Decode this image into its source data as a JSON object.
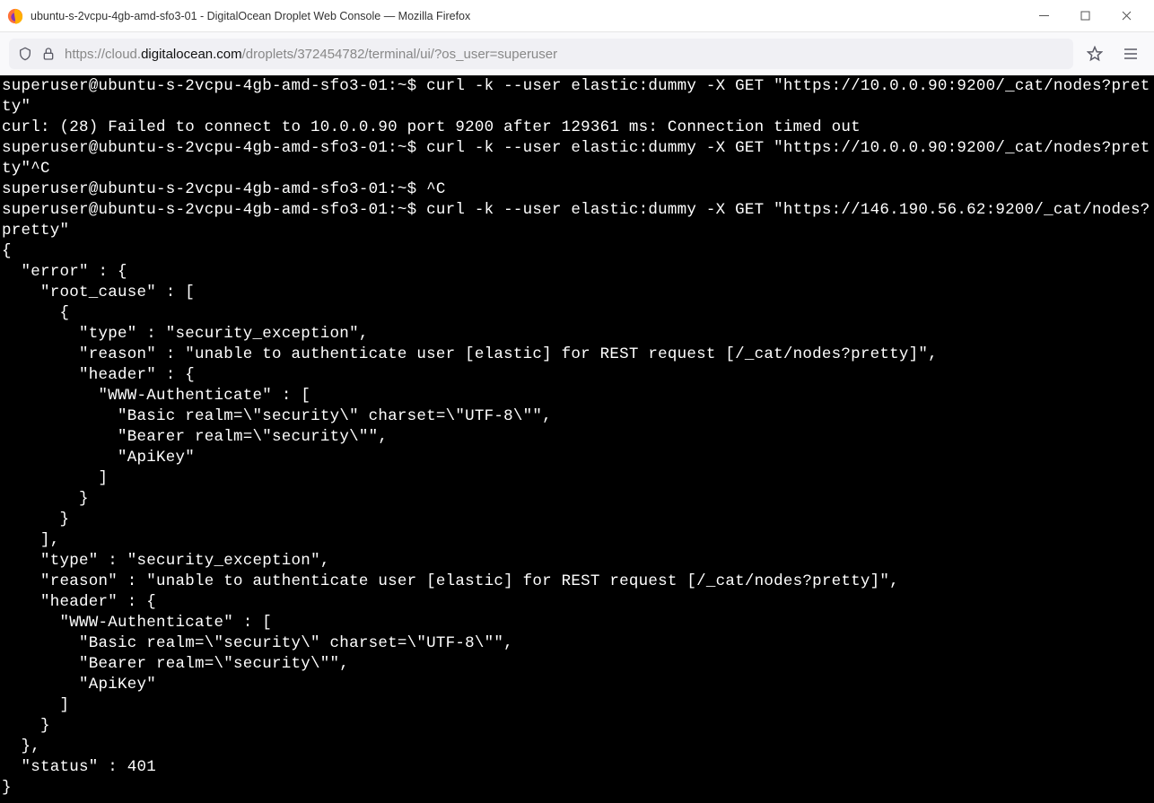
{
  "window": {
    "title": "ubuntu-s-2vcpu-4gb-amd-sfo3-01 - DigitalOcean Droplet Web Console — Mozilla Firefox"
  },
  "address": {
    "protocol": "https://",
    "sub": "cloud.",
    "domain": "digitalocean.com",
    "path": "/droplets/372454782/terminal/ui/?os_user=superuser"
  },
  "terminal": {
    "prompt": "superuser@ubuntu-s-2vcpu-4gb-amd-sfo3-01:~$ ",
    "lines": "superuser@ubuntu-s-2vcpu-4gb-amd-sfo3-01:~$ curl -k --user elastic:dummy -X GET \"https://10.0.0.90:9200/_cat/nodes?pretty\"\ncurl: (28) Failed to connect to 10.0.0.90 port 9200 after 129361 ms: Connection timed out\nsuperuser@ubuntu-s-2vcpu-4gb-amd-sfo3-01:~$ curl -k --user elastic:dummy -X GET \"https://10.0.0.90:9200/_cat/nodes?pretty\"^C\nsuperuser@ubuntu-s-2vcpu-4gb-amd-sfo3-01:~$ ^C\nsuperuser@ubuntu-s-2vcpu-4gb-amd-sfo3-01:~$ curl -k --user elastic:dummy -X GET \"https://146.190.56.62:9200/_cat/nodes?pretty\"\n{\n  \"error\" : {\n    \"root_cause\" : [\n      {\n        \"type\" : \"security_exception\",\n        \"reason\" : \"unable to authenticate user [elastic] for REST request [/_cat/nodes?pretty]\",\n        \"header\" : {\n          \"WWW-Authenticate\" : [\n            \"Basic realm=\\\"security\\\" charset=\\\"UTF-8\\\"\",\n            \"Bearer realm=\\\"security\\\"\",\n            \"ApiKey\"\n          ]\n        }\n      }\n    ],\n    \"type\" : \"security_exception\",\n    \"reason\" : \"unable to authenticate user [elastic] for REST request [/_cat/nodes?pretty]\",\n    \"header\" : {\n      \"WWW-Authenticate\" : [\n        \"Basic realm=\\\"security\\\" charset=\\\"UTF-8\\\"\",\n        \"Bearer realm=\\\"security\\\"\",\n        \"ApiKey\"\n      ]\n    }\n  },\n  \"status\" : 401\n}"
  }
}
